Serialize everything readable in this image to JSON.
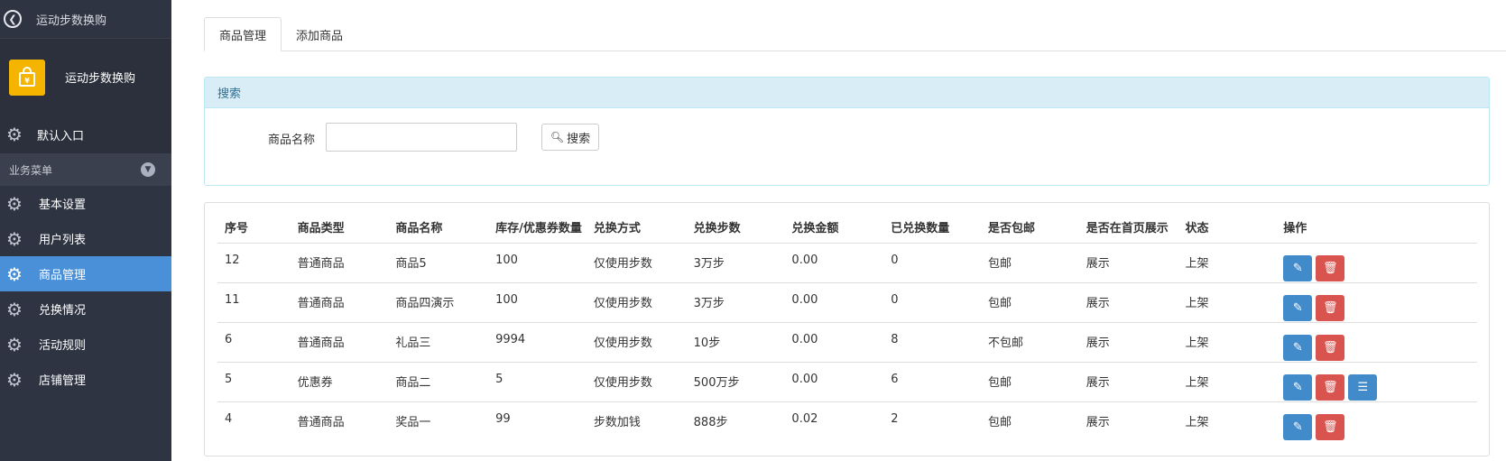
{
  "sidebar": {
    "top_title": "运动步数换购",
    "brand_title": "运动步数换购",
    "default_entry": "默认入口",
    "group_label": "业务菜单",
    "items": [
      {
        "label": "基本设置"
      },
      {
        "label": "用户列表"
      },
      {
        "label": "商品管理"
      },
      {
        "label": "兑换情况"
      },
      {
        "label": "活动规则"
      },
      {
        "label": "店铺管理"
      }
    ],
    "active_index": 2
  },
  "tabs": [
    {
      "label": "商品管理"
    },
    {
      "label": "添加商品"
    }
  ],
  "search": {
    "heading": "搜索",
    "field_label": "商品名称",
    "input_value": "",
    "button_label": "搜索"
  },
  "table": {
    "headers": [
      "序号",
      "商品类型",
      "商品名称",
      "库存/优惠券数量",
      "兑换方式",
      "兑换步数",
      "兑换金额",
      "已兑换数量",
      "是否包邮",
      "是否在首页展示",
      "状态",
      "操作"
    ],
    "rows": [
      {
        "id": "12",
        "type": "普通商品",
        "name": "商品5",
        "stock": "100",
        "method": "仅使用步数",
        "steps": "3万步",
        "amount": "0.00",
        "exchanged": "0",
        "shipping": "包邮",
        "homepage": "展示",
        "status": "上架"
      },
      {
        "id": "11",
        "type": "普通商品",
        "name": "商品四演示",
        "stock": "100",
        "method": "仅使用步数",
        "steps": "3万步",
        "amount": "0.00",
        "exchanged": "0",
        "shipping": "包邮",
        "homepage": "展示",
        "status": "上架"
      },
      {
        "id": "6",
        "type": "普通商品",
        "name": "礼品三",
        "stock": "9994",
        "method": "仅使用步数",
        "steps": "10步",
        "amount": "0.00",
        "exchanged": "8",
        "shipping": "不包邮",
        "homepage": "展示",
        "status": "上架"
      },
      {
        "id": "5",
        "type": "优惠券",
        "name": "商品二",
        "stock": "5",
        "method": "仅使用步数",
        "steps": "500万步",
        "amount": "0.00",
        "exchanged": "6",
        "shipping": "包邮",
        "homepage": "展示",
        "status": "上架"
      },
      {
        "id": "4",
        "type": "普通商品",
        "name": "奖品一",
        "stock": "99",
        "method": "步数加钱",
        "steps": "888步",
        "amount": "0.02",
        "exchanged": "2",
        "shipping": "包邮",
        "homepage": "展示",
        "status": "上架"
      }
    ]
  },
  "colors": {
    "sidebar_bg": "#2f3442",
    "active_menu": "#4a90d9",
    "brand_logo": "#f5b400",
    "edit_button": "#428bca",
    "delete_button": "#d9534f",
    "search_heading_bg": "#d9edf7"
  }
}
